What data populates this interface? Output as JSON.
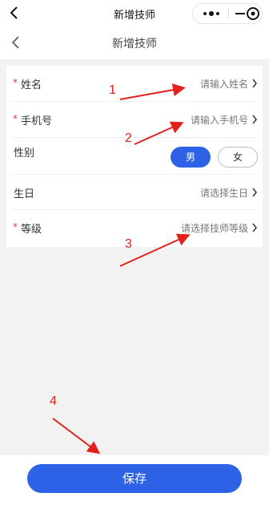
{
  "status_bar": {
    "title": "新增技师"
  },
  "nav": {
    "title": "新增技师"
  },
  "form": {
    "name": {
      "label": "姓名",
      "placeholder": "请输入姓名",
      "required_mark": "*"
    },
    "phone": {
      "label": "手机号",
      "placeholder": "请输入手机号",
      "required_mark": "*"
    },
    "gender": {
      "label": "性别",
      "male": "男",
      "female": "女",
      "selected": "男"
    },
    "birthday": {
      "label": "生日",
      "placeholder": "请选择生日"
    },
    "level": {
      "label": "等级",
      "placeholder": "请选择技师等级",
      "required_mark": "*"
    }
  },
  "annotations": [
    "1",
    "2",
    "3",
    "4"
  ],
  "footer": {
    "save_label": "保存"
  },
  "colors": {
    "primary": "#2d62e6",
    "required": "#e83a3a",
    "annotation": "#e3211b"
  },
  "icons": [
    "back-arrow-icon",
    "more-dots-icon",
    "minimize-icon",
    "close-circle-icon",
    "chevron-right-icon"
  ]
}
